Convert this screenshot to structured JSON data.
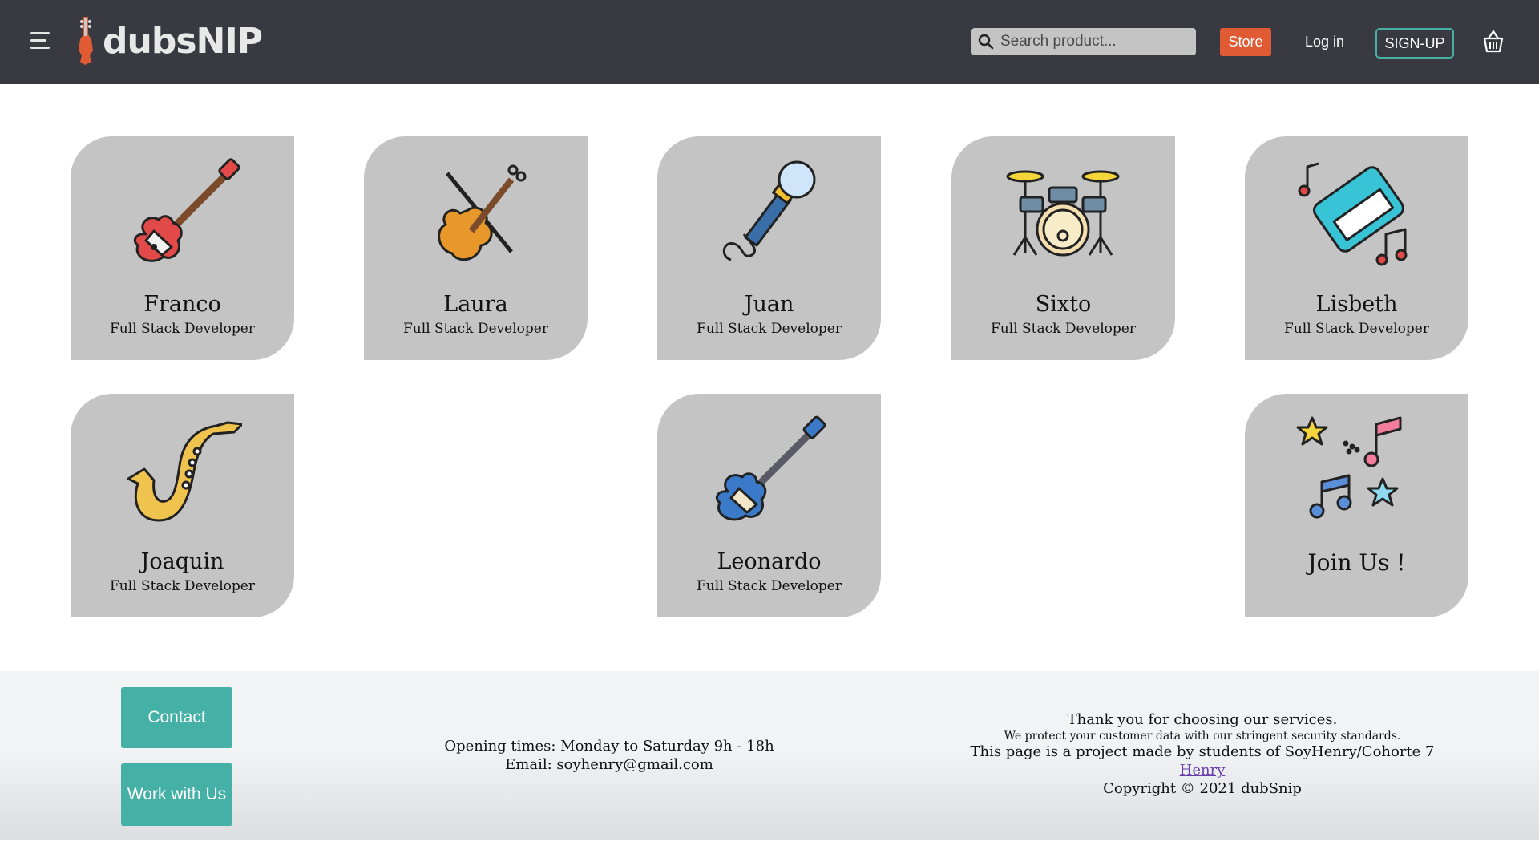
{
  "header": {
    "logo_text": "dubsNIP",
    "search_placeholder": "Search product...",
    "store_label": "Store",
    "login_label": "Log in",
    "signup_label": "SIGN-UP"
  },
  "team": [
    {
      "name": "Franco",
      "role": "Full Stack Developer",
      "icon": "electric-guitar-icon"
    },
    {
      "name": "Laura",
      "role": "Full Stack Developer",
      "icon": "violin-icon"
    },
    {
      "name": "Juan",
      "role": "Full Stack Developer",
      "icon": "microphone-icon"
    },
    {
      "name": "Sixto",
      "role": "Full Stack Developer",
      "icon": "drum-kit-icon"
    },
    {
      "name": "Lisbeth",
      "role": "Full Stack Developer",
      "icon": "keyboard-icon"
    },
    {
      "name": "Joaquin",
      "role": "Full Stack Developer",
      "icon": "saxophone-icon"
    },
    {
      "name": "Leonardo",
      "role": "Full Stack Developer",
      "icon": "bass-guitar-icon"
    }
  ],
  "join": {
    "label": "Join Us !",
    "icon": "music-notes-icon"
  },
  "footer": {
    "contact_label": "Contact",
    "work_label": "Work with Us",
    "opening_times": "Opening times: Monday to Saturday 9h - 18h",
    "email": "Email: soyhenry@gmail.com",
    "thanks": "Thank you for choosing our services.",
    "protect": "We protect your customer data with our stringent security standards.",
    "project": "This page is a project made by students of SoyHenry/Cohorte 7",
    "henry_link": "Henry",
    "copyright": "Copyright © 2021 dubSnip"
  },
  "colors": {
    "header_bg": "#393941",
    "card_bg": "#c4c4c4",
    "accent_teal": "#44b0a6",
    "store_orange": "#e05a34"
  }
}
